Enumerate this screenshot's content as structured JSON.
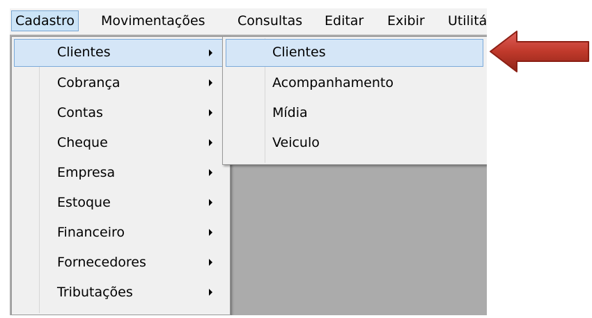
{
  "menubar": {
    "items": [
      {
        "label": "Cadastro"
      },
      {
        "label": "Movimentações"
      },
      {
        "label": "Consultas"
      },
      {
        "label": "Editar"
      },
      {
        "label": "Exibir"
      },
      {
        "label": "Utilitá"
      }
    ]
  },
  "cadastro_menu": {
    "items": [
      {
        "label": "Clientes"
      },
      {
        "label": "Cobrança"
      },
      {
        "label": "Contas"
      },
      {
        "label": "Cheque"
      },
      {
        "label": "Empresa"
      },
      {
        "label": "Estoque"
      },
      {
        "label": "Financeiro"
      },
      {
        "label": "Fornecedores"
      },
      {
        "label": "Tributações"
      }
    ]
  },
  "clientes_submenu": {
    "items": [
      {
        "label": "Clientes"
      },
      {
        "label": "Acompanhamento"
      },
      {
        "label": "Mídia"
      },
      {
        "label": "Veiculo"
      }
    ]
  },
  "colors": {
    "highlight": "#d5e6f7",
    "highlight_border": "#7aa9d9",
    "arrow": "#c0392b"
  }
}
